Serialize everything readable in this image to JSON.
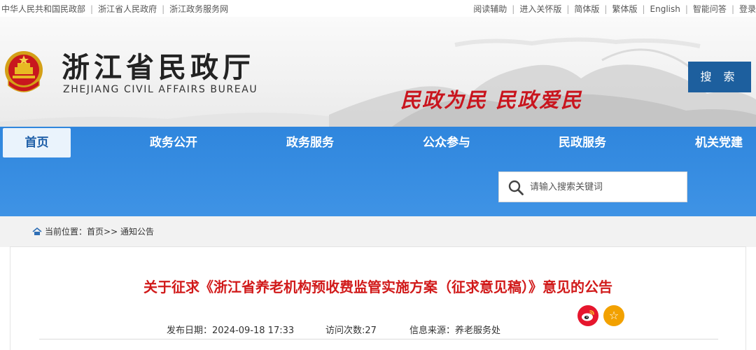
{
  "topbar": {
    "left_links": [
      "中华人民共和国民政部",
      "浙江省人民政府",
      "浙江政务服务网"
    ],
    "right_links": [
      "阅读辅助",
      "进入关怀版",
      "简体版",
      "繁体版",
      "English",
      "智能问答",
      "登录"
    ]
  },
  "header": {
    "title_cn": "浙江省民政厅",
    "title_en": "ZHEJIANG CIVIL AFFAIRS BUREAU",
    "slogan": "民政为民  民政爱民"
  },
  "nav": {
    "items": [
      "首页",
      "政务公开",
      "政务服务",
      "公众参与",
      "民政服务",
      "机关党建"
    ],
    "active_index": 0
  },
  "search": {
    "placeholder": "请输入搜索关键词",
    "button_label": "搜 索"
  },
  "breadcrumb": {
    "prefix": "当前位置：",
    "home": "首页",
    "sep": ">>",
    "current": "通知公告"
  },
  "article": {
    "title": "关于征求《浙江省养老机构预收费监管实施方案（征求意见稿）》意见的公告",
    "publish_date": "发布日期：2024-09-18 17:33",
    "visits": "访问次数:27",
    "source": "信息来源：养老服务处"
  },
  "share": {
    "weibo_icon": "weibo-icon",
    "favorite_icon": "star-icon"
  },
  "colors": {
    "nav_blue": "#3f93e5",
    "search_button": "#1d5f9e",
    "title_red": "#d11a1a",
    "slogan_red": "#c9151e"
  }
}
